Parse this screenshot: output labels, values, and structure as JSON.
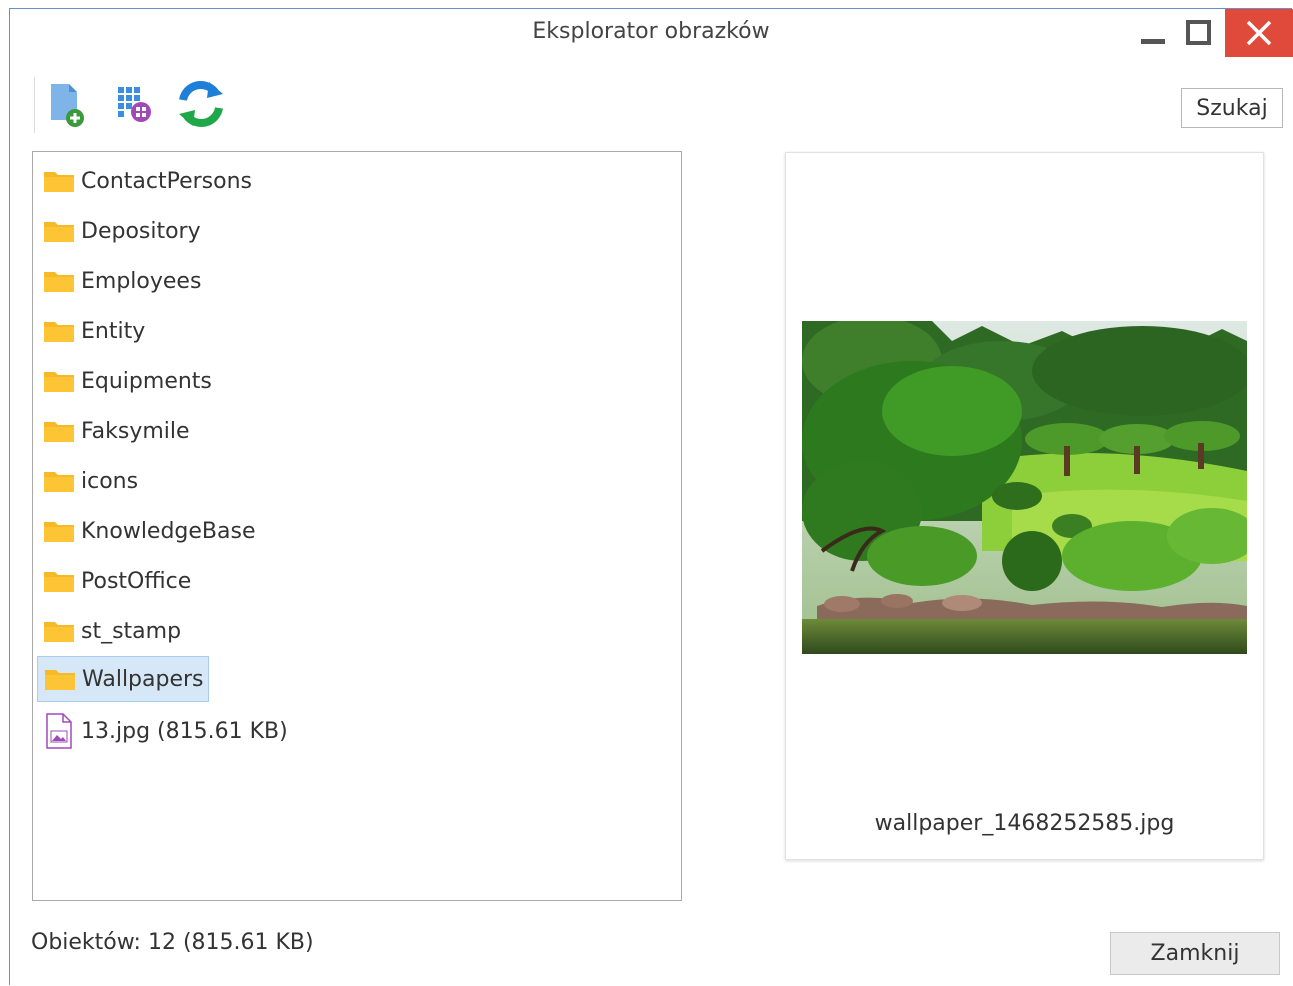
{
  "window": {
    "title": "Eksplorator obrazków",
    "controls": [
      "minimize-icon",
      "maximize-icon",
      "close-icon"
    ],
    "close_color": "#e04a3a"
  },
  "toolbar": {
    "buttons": [
      {
        "name": "new-file-button",
        "icon": "file-add-icon"
      },
      {
        "name": "thumbnails-button",
        "icon": "grid-view-icon"
      },
      {
        "name": "refresh-button",
        "icon": "refresh-icon"
      }
    ],
    "search_label": "Szukaj"
  },
  "tree": {
    "items": [
      {
        "label": "ContactPersons",
        "type": "folder"
      },
      {
        "label": "Depository",
        "type": "folder"
      },
      {
        "label": "Employees",
        "type": "folder"
      },
      {
        "label": "Entity",
        "type": "folder"
      },
      {
        "label": "Equipments",
        "type": "folder"
      },
      {
        "label": "Faksymile",
        "type": "folder"
      },
      {
        "label": "icons",
        "type": "folder"
      },
      {
        "label": "KnowledgeBase",
        "type": "folder"
      },
      {
        "label": "PostOffice",
        "type": "folder"
      },
      {
        "label": "st_stamp",
        "type": "folder"
      },
      {
        "label": "Wallpapers",
        "type": "folder",
        "selected": true
      },
      {
        "label": "13.jpg (815.61 KB)",
        "type": "image-file"
      }
    ],
    "selected_color": "#d6e8f7",
    "folder_color": "#f7b928"
  },
  "preview": {
    "caption": "wallpaper_1468252585.jpg"
  },
  "footer": {
    "status": "Obiektów: 12 (815.61 KB)",
    "close_label": "Zamknij"
  }
}
